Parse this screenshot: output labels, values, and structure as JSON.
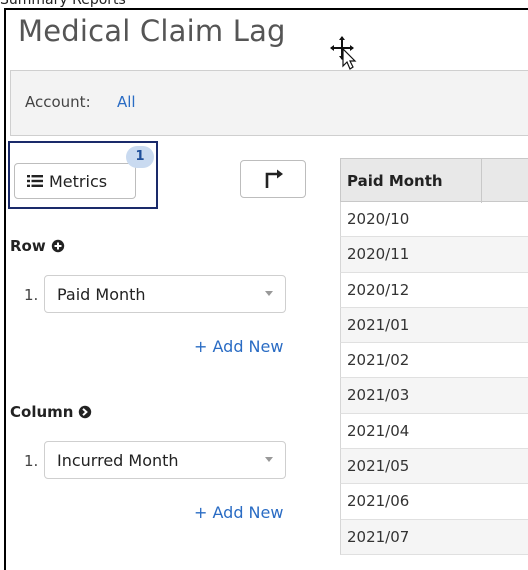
{
  "top_cut_text": "Summary Reports",
  "page_title": "Medical Claim Lag",
  "account": {
    "label": "Account:",
    "value": "All"
  },
  "metrics": {
    "label": "Metrics",
    "badge": "1"
  },
  "row_section": {
    "label": "Row",
    "items": [
      {
        "num": "1.",
        "value": "Paid Month"
      }
    ],
    "add_new": "+ Add New"
  },
  "column_section": {
    "label": "Column",
    "items": [
      {
        "num": "1.",
        "value": "Incurred Month"
      }
    ],
    "add_new": "+ Add New"
  },
  "table": {
    "header": "Paid Month",
    "rows": [
      "2020/10",
      "2020/11",
      "2020/12",
      "2021/01",
      "2021/02",
      "2021/03",
      "2021/04",
      "2021/05",
      "2021/06",
      "2021/07"
    ]
  },
  "colors": {
    "link": "#2a6cc4",
    "badge_bg": "#c9daf0",
    "highlight_border": "#1a2a6a"
  },
  "icons": {
    "metrics": "list-icon",
    "pivot": "pivot-arrow-icon",
    "row": "circle-plus-icon",
    "column": "circle-arrow-right-icon",
    "cursor": "move-cursor-icon"
  }
}
